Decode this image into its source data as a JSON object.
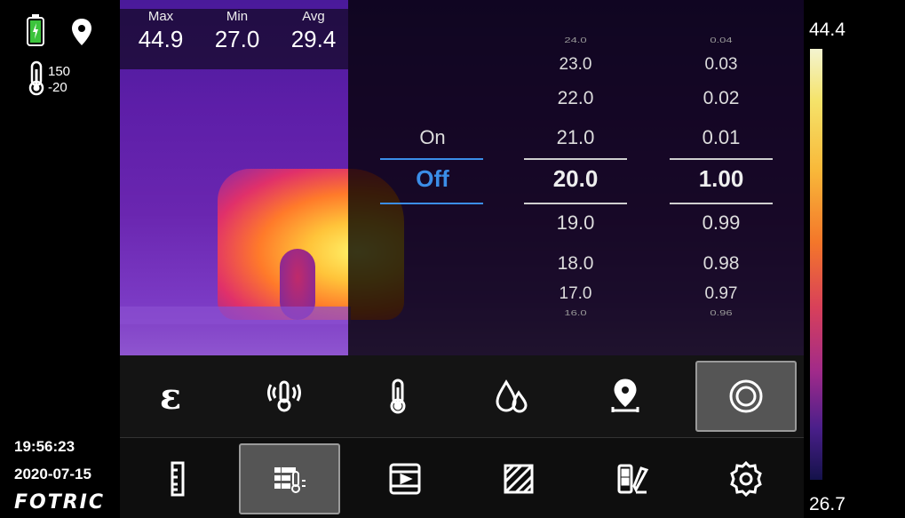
{
  "status": {
    "temp_range_high": "150",
    "temp_range_low": "-20",
    "time": "19:56:23",
    "date": "2020-07-15",
    "brand": "FOTRIC",
    "battery_color": "#3cc43c"
  },
  "stats": {
    "max_label": "Max",
    "max_value": "44.9",
    "min_label": "Min",
    "min_value": "27.0",
    "avg_label": "Avg",
    "avg_value": "29.4"
  },
  "picker": {
    "toggle": {
      "above": "On",
      "selected": "Off"
    },
    "temperature": {
      "above": [
        "24.0",
        "23.0",
        "22.0",
        "21.0"
      ],
      "selected": "20.0",
      "below": [
        "19.0",
        "18.0",
        "17.0",
        "16.0"
      ]
    },
    "emissivity": {
      "above": [
        "0.04",
        "0.03",
        "0.02",
        "0.01"
      ],
      "selected": "1.00",
      "below": [
        "0.99",
        "0.98",
        "0.97",
        "0.96"
      ]
    },
    "accent_color": "#3b8ee8"
  },
  "scale": {
    "max": "44.4",
    "min": "26.7"
  },
  "toolbar_top": [
    {
      "icon": "emissivity-icon",
      "glyph": "ε"
    },
    {
      "icon": "reflected-temperature-icon"
    },
    {
      "icon": "thermometer-icon"
    },
    {
      "icon": "humidity-icon"
    },
    {
      "icon": "location-distance-icon"
    },
    {
      "icon": "lens-icon",
      "active": true
    }
  ],
  "toolbar_bottom": [
    {
      "icon": "ruler-icon"
    },
    {
      "icon": "parameters-icon",
      "active": true
    },
    {
      "icon": "video-playback-icon"
    },
    {
      "icon": "area-icon"
    },
    {
      "icon": "palette-icon"
    },
    {
      "icon": "settings-gear-icon"
    }
  ]
}
